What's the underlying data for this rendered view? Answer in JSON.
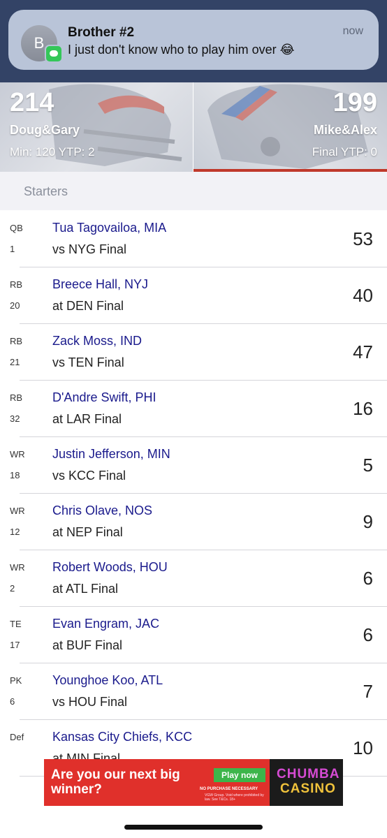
{
  "notification": {
    "avatar_letter": "B",
    "sender": "Brother #2",
    "text": "I just don't know who to play him over 😂",
    "time": "now"
  },
  "matchup": {
    "home": {
      "score": "214",
      "team": "Doug&Gary",
      "meta": "Min: 120 YTP: 2"
    },
    "away": {
      "score": "199",
      "team": "Mike&Alex",
      "meta": "Final YTP: 0"
    },
    "accent_color": "#c0392b"
  },
  "section": {
    "title": "Starters"
  },
  "starters": [
    {
      "pos": "QB",
      "rank": "1",
      "player": "Tua Tagovailoa, MIA",
      "game": "vs NYG  Final",
      "points": "53"
    },
    {
      "pos": "RB",
      "rank": "20",
      "player": "Breece Hall, NYJ",
      "game": "at DEN  Final",
      "points": "40"
    },
    {
      "pos": "RB",
      "rank": "21",
      "player": "Zack Moss, IND",
      "game": "vs TEN  Final",
      "points": "47"
    },
    {
      "pos": "RB",
      "rank": "32",
      "player": "D'Andre Swift, PHI",
      "game": "at LAR  Final",
      "points": "16"
    },
    {
      "pos": "WR",
      "rank": "18",
      "player": "Justin Jefferson, MIN",
      "game": "vs KCC  Final",
      "points": "5"
    },
    {
      "pos": "WR",
      "rank": "12",
      "player": "Chris Olave, NOS",
      "game": "at NEP  Final",
      "points": "9"
    },
    {
      "pos": "WR",
      "rank": "2",
      "player": "Robert Woods, HOU",
      "game": "at ATL  Final",
      "points": "6"
    },
    {
      "pos": "TE",
      "rank": "17",
      "player": "Evan Engram, JAC",
      "game": "at BUF  Final",
      "points": "6"
    },
    {
      "pos": "PK",
      "rank": "6",
      "player": "Younghoe Koo, ATL",
      "game": "vs HOU  Final",
      "points": "7"
    },
    {
      "pos": "Def",
      "rank": "",
      "player": "Kansas City Chiefs, KCC",
      "game": "at MIN  Final",
      "points": "10"
    }
  ],
  "ad": {
    "headline": "Are you our next big winner?",
    "button": "Play now",
    "fine_print_1": "NO PURCHASE NECESSARY",
    "fine_print_2": "VGW Group. Void where prohibited by law. See T&Cs. 18+",
    "brand_line_1": "CHUMBA",
    "brand_line_2": "CASINO"
  }
}
